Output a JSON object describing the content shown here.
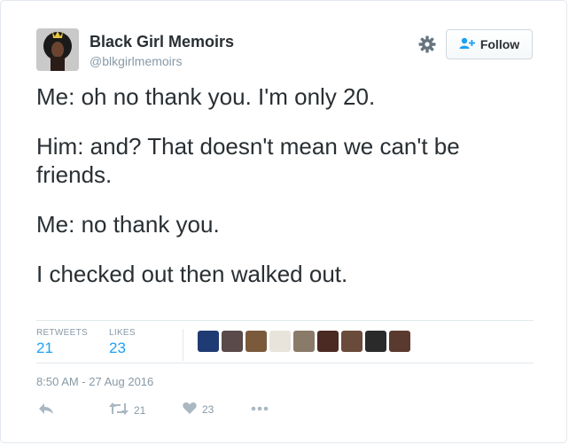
{
  "user": {
    "name": "Black Girl Memoirs",
    "handle": "@blkgirlmemoirs"
  },
  "follow_button": {
    "label": "Follow",
    "icon": "add-user-icon"
  },
  "settings_icon": "gear-icon",
  "tweet": {
    "lines": [
      "Me: oh no thank you. I'm only 20.",
      "Him: and? That doesn't mean we can't be friends.",
      "Me: no thank you.",
      "I checked out then walked out."
    ]
  },
  "stats": {
    "retweets_label": "RETWEETS",
    "retweets_count": "21",
    "likes_label": "LIKES",
    "likes_count": "23"
  },
  "liker_avatars": [
    {
      "name": "avatar-1",
      "color": "#1f3b73"
    },
    {
      "name": "avatar-2",
      "color": "#5a4a4a"
    },
    {
      "name": "avatar-3",
      "color": "#7a5a3a"
    },
    {
      "name": "avatar-4",
      "color": "#e8e4dc"
    },
    {
      "name": "avatar-5",
      "color": "#8a7a6a"
    },
    {
      "name": "avatar-6",
      "color": "#4a2a22"
    },
    {
      "name": "avatar-7",
      "color": "#6a4a3a"
    },
    {
      "name": "avatar-8",
      "color": "#2a2a2a"
    },
    {
      "name": "avatar-9",
      "color": "#5a3a2e"
    }
  ],
  "timestamp": "8:50 AM - 27 Aug 2016",
  "actions": {
    "reply_icon": "reply-icon",
    "retweet_icon": "retweet-icon",
    "retweet_count": "21",
    "like_icon": "heart-icon",
    "like_count": "23",
    "more_icon": "more-icon"
  },
  "colors": {
    "accent": "#1da1f2",
    "muted": "#8899a6",
    "text": "#292f33",
    "border": "#e1e8ed"
  }
}
